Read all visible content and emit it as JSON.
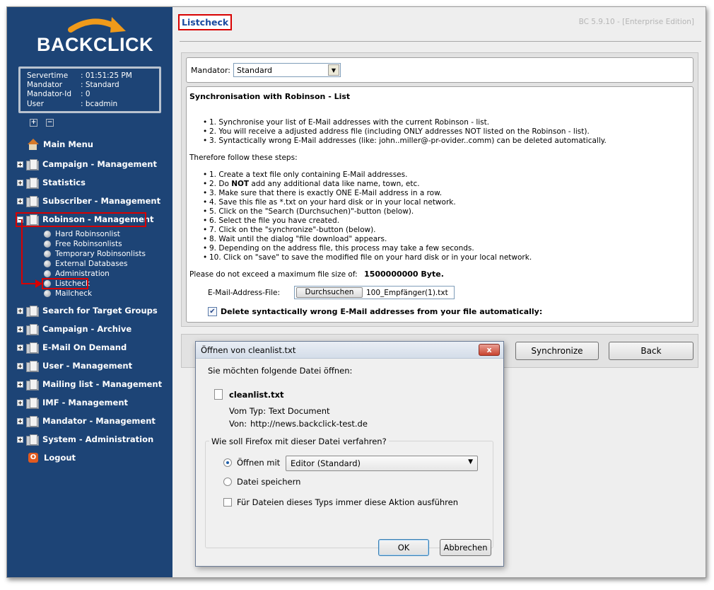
{
  "sidebar": {
    "logo": "BACKCLICK",
    "info": [
      {
        "key": "Servertime",
        "value": ": 01:51:25 PM"
      },
      {
        "key": "Mandator",
        "value": ": Standard"
      },
      {
        "key": "Mandator-Id",
        "value": ": 0"
      },
      {
        "key": "User",
        "value": ": bcadmin"
      }
    ],
    "main_menu": "Main Menu",
    "items": [
      {
        "label": "Campaign - Management"
      },
      {
        "label": "Statistics"
      },
      {
        "label": "Subscriber - Management"
      },
      {
        "label": "Robinson - Management"
      }
    ],
    "robinson_sub": [
      "Hard Robinsonlist",
      "Free Robinsonlists",
      "Temporary Robinsonlists",
      "External Databases",
      "Administration",
      "Listcheck",
      "Mailcheck"
    ],
    "items_after": [
      {
        "label": "Search for Target Groups"
      },
      {
        "label": "Campaign - Archive"
      },
      {
        "label": "E-Mail On Demand"
      },
      {
        "label": "User - Management"
      },
      {
        "label": "Mailing list - Management"
      },
      {
        "label": "IMF - Management"
      },
      {
        "label": "Mandator - Management"
      },
      {
        "label": "System - Administration"
      }
    ],
    "logout": "Logout"
  },
  "main": {
    "title": "Listcheck",
    "version": "BC 5.9.10 - [Enterprise Edition]",
    "mandator_label": "Mandator:",
    "mandator_value": "Standard",
    "heading": "Synchronisation with Robinson - List",
    "intro_list": [
      "1. Synchronise your list of E-Mail addresses with the current Robinson - list.",
      "2. You will receive a adjusted address file (including ONLY addresses NOT listed on the Robinson - list).",
      "3. Syntactically wrong E-Mail addresses (like: john..miller@-pr-ovider..comm) can be deleted automatically."
    ],
    "steps_intro": "Therefore follow these steps:",
    "steps": {
      "s1": "1. Create a text file only containing E-Mail addresses.",
      "s2_pre": "2. Do ",
      "s2_bold": "NOT",
      "s2_post": " add any additional data like name, town, etc.",
      "s3": "3. Make sure that there is exactly ONE E-Mail address in a row.",
      "s4": "4. Save this file as *.txt on your hard disk or in your local network.",
      "s5": "5. Click on the \"Search (Durchsuchen)\"-button (below).",
      "s6": "6. Select the file you have created.",
      "s7": "7. Click on the \"synchronize\"-button (below).",
      "s8": "8. Wait until the dialog \"file download\" appears.",
      "s9": "9. Depending on the address file, this process may take a few seconds.",
      "s10": "10. Click on \"save\" to save the modified file on your hard disk or in your local network."
    },
    "filesize_text": "Please do not exceed a maximum file size of:",
    "filesize_value": "1500000000 Byte.",
    "file_label": "E-Mail-Address-File:",
    "browse_label": "Durchsuchen",
    "file_name": "100_Empfänger(1).txt",
    "delete_label": "Delete syntactically wrong E-Mail addresses from your file automatically:",
    "synchronize_label": "Synchronize",
    "back_label": "Back"
  },
  "dialog": {
    "title": "Öffnen von cleanlist.txt",
    "close": "x",
    "prompt": "Sie möchten folgende Datei öffnen:",
    "filename": "cleanlist.txt",
    "type_label": "Vom Typ:",
    "type_value": "Text Document",
    "from_label": "Von:",
    "from_value": "http://news.backclick-test.de",
    "question": "Wie soll Firefox mit dieser Datei verfahren?",
    "open_with": "Öffnen mit",
    "open_with_app": "Editor (Standard)",
    "save_file": "Datei speichern",
    "always": "Für Dateien dieses Typs immer diese Aktion ausführen",
    "ok": "OK",
    "cancel": "Abbrechen"
  }
}
